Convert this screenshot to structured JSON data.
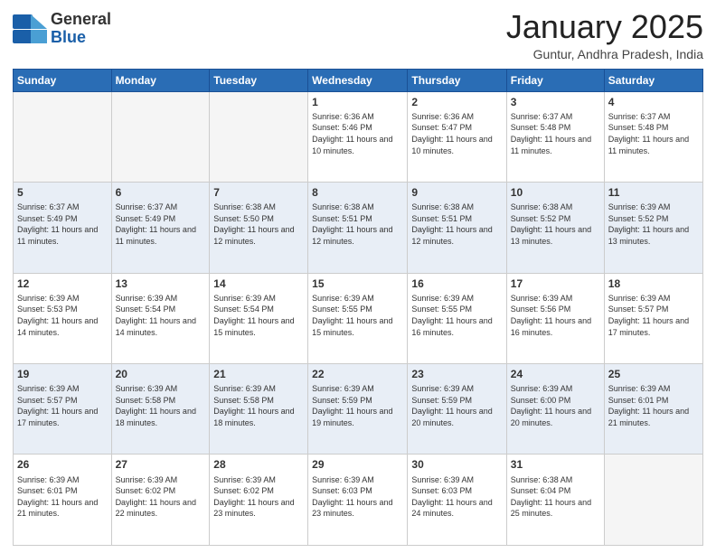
{
  "logo": {
    "general": "General",
    "blue": "Blue"
  },
  "header": {
    "month": "January 2025",
    "location": "Guntur, Andhra Pradesh, India"
  },
  "days_of_week": [
    "Sunday",
    "Monday",
    "Tuesday",
    "Wednesday",
    "Thursday",
    "Friday",
    "Saturday"
  ],
  "weeks": [
    [
      {
        "day": "",
        "info": ""
      },
      {
        "day": "",
        "info": ""
      },
      {
        "day": "",
        "info": ""
      },
      {
        "day": "1",
        "info": "Sunrise: 6:36 AM\nSunset: 5:46 PM\nDaylight: 11 hours\nand 10 minutes."
      },
      {
        "day": "2",
        "info": "Sunrise: 6:36 AM\nSunset: 5:47 PM\nDaylight: 11 hours\nand 10 minutes."
      },
      {
        "day": "3",
        "info": "Sunrise: 6:37 AM\nSunset: 5:48 PM\nDaylight: 11 hours\nand 11 minutes."
      },
      {
        "day": "4",
        "info": "Sunrise: 6:37 AM\nSunset: 5:48 PM\nDaylight: 11 hours\nand 11 minutes."
      }
    ],
    [
      {
        "day": "5",
        "info": "Sunrise: 6:37 AM\nSunset: 5:49 PM\nDaylight: 11 hours\nand 11 minutes."
      },
      {
        "day": "6",
        "info": "Sunrise: 6:37 AM\nSunset: 5:49 PM\nDaylight: 11 hours\nand 11 minutes."
      },
      {
        "day": "7",
        "info": "Sunrise: 6:38 AM\nSunset: 5:50 PM\nDaylight: 11 hours\nand 12 minutes."
      },
      {
        "day": "8",
        "info": "Sunrise: 6:38 AM\nSunset: 5:51 PM\nDaylight: 11 hours\nand 12 minutes."
      },
      {
        "day": "9",
        "info": "Sunrise: 6:38 AM\nSunset: 5:51 PM\nDaylight: 11 hours\nand 12 minutes."
      },
      {
        "day": "10",
        "info": "Sunrise: 6:38 AM\nSunset: 5:52 PM\nDaylight: 11 hours\nand 13 minutes."
      },
      {
        "day": "11",
        "info": "Sunrise: 6:39 AM\nSunset: 5:52 PM\nDaylight: 11 hours\nand 13 minutes."
      }
    ],
    [
      {
        "day": "12",
        "info": "Sunrise: 6:39 AM\nSunset: 5:53 PM\nDaylight: 11 hours\nand 14 minutes."
      },
      {
        "day": "13",
        "info": "Sunrise: 6:39 AM\nSunset: 5:54 PM\nDaylight: 11 hours\nand 14 minutes."
      },
      {
        "day": "14",
        "info": "Sunrise: 6:39 AM\nSunset: 5:54 PM\nDaylight: 11 hours\nand 15 minutes."
      },
      {
        "day": "15",
        "info": "Sunrise: 6:39 AM\nSunset: 5:55 PM\nDaylight: 11 hours\nand 15 minutes."
      },
      {
        "day": "16",
        "info": "Sunrise: 6:39 AM\nSunset: 5:55 PM\nDaylight: 11 hours\nand 16 minutes."
      },
      {
        "day": "17",
        "info": "Sunrise: 6:39 AM\nSunset: 5:56 PM\nDaylight: 11 hours\nand 16 minutes."
      },
      {
        "day": "18",
        "info": "Sunrise: 6:39 AM\nSunset: 5:57 PM\nDaylight: 11 hours\nand 17 minutes."
      }
    ],
    [
      {
        "day": "19",
        "info": "Sunrise: 6:39 AM\nSunset: 5:57 PM\nDaylight: 11 hours\nand 17 minutes."
      },
      {
        "day": "20",
        "info": "Sunrise: 6:39 AM\nSunset: 5:58 PM\nDaylight: 11 hours\nand 18 minutes."
      },
      {
        "day": "21",
        "info": "Sunrise: 6:39 AM\nSunset: 5:58 PM\nDaylight: 11 hours\nand 18 minutes."
      },
      {
        "day": "22",
        "info": "Sunrise: 6:39 AM\nSunset: 5:59 PM\nDaylight: 11 hours\nand 19 minutes."
      },
      {
        "day": "23",
        "info": "Sunrise: 6:39 AM\nSunset: 5:59 PM\nDaylight: 11 hours\nand 20 minutes."
      },
      {
        "day": "24",
        "info": "Sunrise: 6:39 AM\nSunset: 6:00 PM\nDaylight: 11 hours\nand 20 minutes."
      },
      {
        "day": "25",
        "info": "Sunrise: 6:39 AM\nSunset: 6:01 PM\nDaylight: 11 hours\nand 21 minutes."
      }
    ],
    [
      {
        "day": "26",
        "info": "Sunrise: 6:39 AM\nSunset: 6:01 PM\nDaylight: 11 hours\nand 21 minutes."
      },
      {
        "day": "27",
        "info": "Sunrise: 6:39 AM\nSunset: 6:02 PM\nDaylight: 11 hours\nand 22 minutes."
      },
      {
        "day": "28",
        "info": "Sunrise: 6:39 AM\nSunset: 6:02 PM\nDaylight: 11 hours\nand 23 minutes."
      },
      {
        "day": "29",
        "info": "Sunrise: 6:39 AM\nSunset: 6:03 PM\nDaylight: 11 hours\nand 23 minutes."
      },
      {
        "day": "30",
        "info": "Sunrise: 6:39 AM\nSunset: 6:03 PM\nDaylight: 11 hours\nand 24 minutes."
      },
      {
        "day": "31",
        "info": "Sunrise: 6:38 AM\nSunset: 6:04 PM\nDaylight: 11 hours\nand 25 minutes."
      },
      {
        "day": "",
        "info": ""
      }
    ]
  ]
}
